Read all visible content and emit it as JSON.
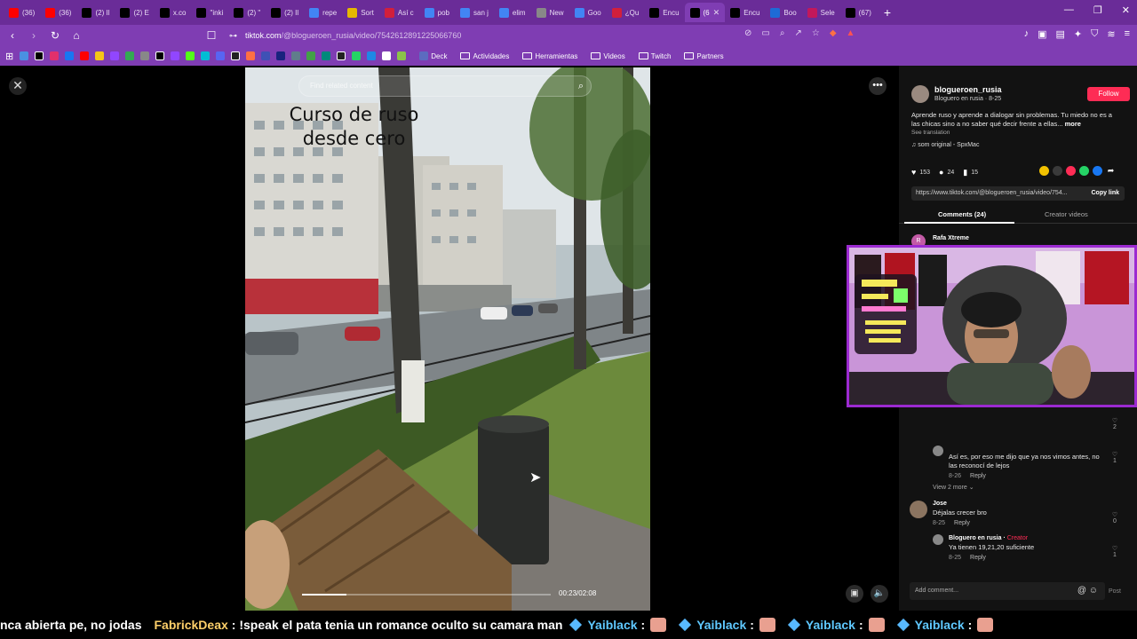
{
  "browser": {
    "tabs": [
      {
        "label": "(36)",
        "color": "#ff0000",
        "icon": "youtube-icon"
      },
      {
        "label": "(36)",
        "color": "#ff0000",
        "icon": "youtube-icon"
      },
      {
        "label": "(2) Il",
        "color": "#000000",
        "icon": "x-icon"
      },
      {
        "label": "(2) E",
        "color": "#000000",
        "icon": "x-icon"
      },
      {
        "label": "x.co",
        "color": "#000000",
        "icon": "x-icon"
      },
      {
        "label": "\"inki",
        "color": "#000000",
        "icon": "x-icon"
      },
      {
        "label": "(2) \"",
        "color": "#000000",
        "icon": "x-icon"
      },
      {
        "label": "(2) Il",
        "color": "#000000",
        "icon": "x-icon"
      },
      {
        "label": "repe",
        "color": "#4285f4",
        "icon": "google-icon"
      },
      {
        "label": "Sort",
        "color": "#e6b800",
        "icon": "sort-icon"
      },
      {
        "label": "Así c",
        "color": "#d21f3c",
        "icon": "news-icon"
      },
      {
        "label": "pob",
        "color": "#4285f4",
        "icon": "google-icon"
      },
      {
        "label": "san j",
        "color": "#4285f4",
        "icon": "google-icon"
      },
      {
        "label": "elim",
        "color": "#4285f4",
        "icon": "google-icon"
      },
      {
        "label": "New",
        "color": "#888888",
        "icon": "globe-icon"
      },
      {
        "label": "Goo",
        "color": "#4285f4",
        "icon": "google-icon"
      },
      {
        "label": "¿Qu",
        "color": "#d21f3c",
        "icon": "news-icon"
      },
      {
        "label": "Encu",
        "color": "#000000",
        "icon": "tiktok-icon"
      },
      {
        "label": "(6",
        "color": "#000000",
        "icon": "audio-icon",
        "active": true
      },
      {
        "label": "Encu",
        "color": "#000000",
        "icon": "tiktok-icon"
      },
      {
        "label": "Boo",
        "color": "#1e6bd6",
        "icon": "booking-icon"
      },
      {
        "label": "Sele",
        "color": "#c2185b",
        "icon": "select-icon"
      },
      {
        "label": "(67)",
        "color": "#000000",
        "icon": "tiktok-icon"
      }
    ],
    "url_host": "tiktok.com",
    "url_path": "/@blogueroen_rusia/video/7542612891225066760",
    "bookmarks": [
      "Deck",
      "Actividades",
      "Herramientas",
      "Videos",
      "Twitch",
      "Partners"
    ],
    "accent": "#7f3db3"
  },
  "video": {
    "search_placeholder": "Find related content",
    "caption": "Curso de ruso desde cero",
    "time": "00:23/02:08",
    "progress": 0.18
  },
  "post": {
    "author_handle": "blogueroen_rusia",
    "author_name": "Bloguero en rusia · 8-25",
    "follow": "Follow",
    "description": "Aprende ruso y aprende a dialogar sin problemas. Tu miedo no es a las chicas sino a no saber qué decir frente a ellas...",
    "more": "more",
    "see_translation": "See translation",
    "sound": "som original - SpxMac",
    "likes": "153",
    "comments": "24",
    "saves": "15",
    "link": "https://www.tiktok.com/@blogueroen_rusia/video/754...",
    "copy_link": "Copy link",
    "tab_comments": "Comments (24)",
    "tab_creator": "Creator videos"
  },
  "comments": {
    "top_name": "Rafa Xtreme",
    "top_initial": "R",
    "c1_text": "Así es, por eso me dijo que ya nos vimos antes, no las reconocí de lejos",
    "c1_meta": "8-26",
    "reply": "Reply",
    "like_c0": "2",
    "like_c1": "1",
    "view_more": "View 2 more",
    "c2_name": "Jose",
    "c2_text": "Déjalas crecer bro",
    "c2_meta": "8-25",
    "like_c2": "0",
    "c3_name": "Bloguero en rusia",
    "c3_tag": "Creator",
    "c3_text": "Ya tienen 19,21,20 suficiente",
    "c3_meta": "8-25",
    "like_c3": "1",
    "add_comment": "Add comment...",
    "post": "Post"
  },
  "ticker": {
    "t1": "nca abierta pe, no jodas",
    "user2": "FabrickDeax",
    "t2": ": !speak el pata tenia un romance oculto su camara man",
    "user3": "Yaiblack",
    "t3": ":"
  }
}
